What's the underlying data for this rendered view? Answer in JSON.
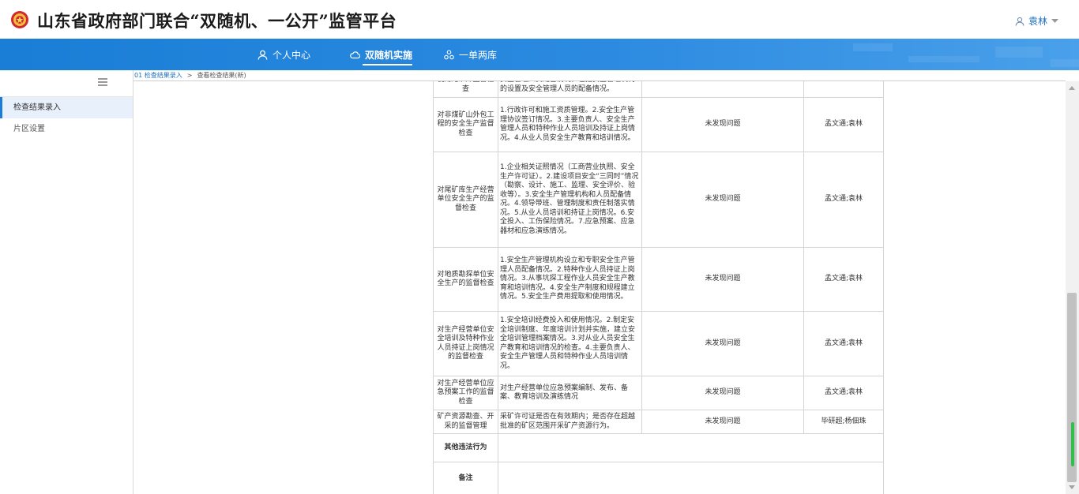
{
  "header": {
    "title": "山东省政府部门联合“双随机、一公开”监管平台",
    "user": "袁林"
  },
  "nav": {
    "items": [
      {
        "label": "个人中心",
        "icon": "person-icon"
      },
      {
        "label": "双随机实施",
        "icon": "cloud-icon",
        "active": true
      },
      {
        "label": "一单两库",
        "icon": "database-icon"
      }
    ]
  },
  "sidebar": {
    "items": [
      {
        "label": "检查结果录入",
        "active": true
      },
      {
        "label": "片区设置"
      }
    ]
  },
  "breadcrumb": {
    "items": [
      "01 检查结果录入",
      "查看检查结果(新)"
    ],
    "separator": ">"
  },
  "table": {
    "rows": [
      {
        "item": "使用尾矿库监督检查",
        "desc": "安全管理人员配备情况，包括安全管理机构的设置及安全管理人员的配备情况。",
        "result": "",
        "staff": ""
      },
      {
        "item": "对非煤矿山外包工程的安全生产监督检查",
        "desc": "1.行政许可和施工资质管理。2.安全生产管理协议签订情况。3.主要负责人、安全生产管理人员和特种作业人员培训及持证上岗情况。4.从业人员安全生产教育和培训情况。",
        "result": "未发现问题",
        "staff": "孟文通;袁林"
      },
      {
        "item": "对尾矿库生产经营单位安全生产的监督检查",
        "desc": "1.企业相关证照情况（工商营业执照、安全生产许可证）。2.建设项目安全“三同时”情况（勘察、设计、施工、监理、安全评价、验收等）。3.安全生产管理机构和人员配备情况。4.领导带班、管理制度和责任制落实情况。5.从业人员培训和持证上岗情况。6.安全投入、工伤保险情况。7.应急预案、应急器材和应急演练情况。",
        "result": "未发现问题",
        "staff": "孟文通;袁林"
      },
      {
        "item": "对地质勘探单位安全生产的监督检查",
        "desc": "1.安全生产管理机构设立和专职安全生产管理人员配备情况。2.特种作业人员持证上岗情况。3.从事坑探工程作业人员安全生产教育和培训情况。4.安全生产制度和规程建立情况。5.安全生产费用提取和使用情况。",
        "result": "未发现问题",
        "staff": "孟文通;袁林"
      },
      {
        "item": "对生产经营单位安全培训及特种作业人员持证上岗情况的监督检查",
        "desc": "1.安全培训经费投入和使用情况。2.制定安全培训制度、年度培训计划并实施，建立安全培训管理档案情况。3.对从业人员安全生产教育和培训情况的检查。4.主要负责人、安全生产管理人员和特种作业人员培训情况。",
        "result": "未发现问题",
        "staff": "孟文通;袁林"
      },
      {
        "item": "对生产经营单位应急预案工作的监督检查",
        "desc": "对生产经营单位应急预案编制、发布、备案、教育培训及演练情况",
        "result": "未发现问题",
        "staff": "孟文通;袁林"
      },
      {
        "item": "矿产资源勘查、开采的监督管理",
        "desc": "采矿许可证是否在有效期内；是否存在超越批准的矿区范围开采矿产资源行为。",
        "result": "未发现问题",
        "staff": "毕研超;杨佃珠"
      }
    ],
    "other_label": "其他违法行为",
    "other_value": "",
    "remark_label": "备注",
    "remark_value": ""
  },
  "colors": {
    "nav_start": "#1a7ed6",
    "nav_end": "#4aa0ea",
    "accent": "#1e6fbf",
    "label_text": "#3b5a8a"
  }
}
